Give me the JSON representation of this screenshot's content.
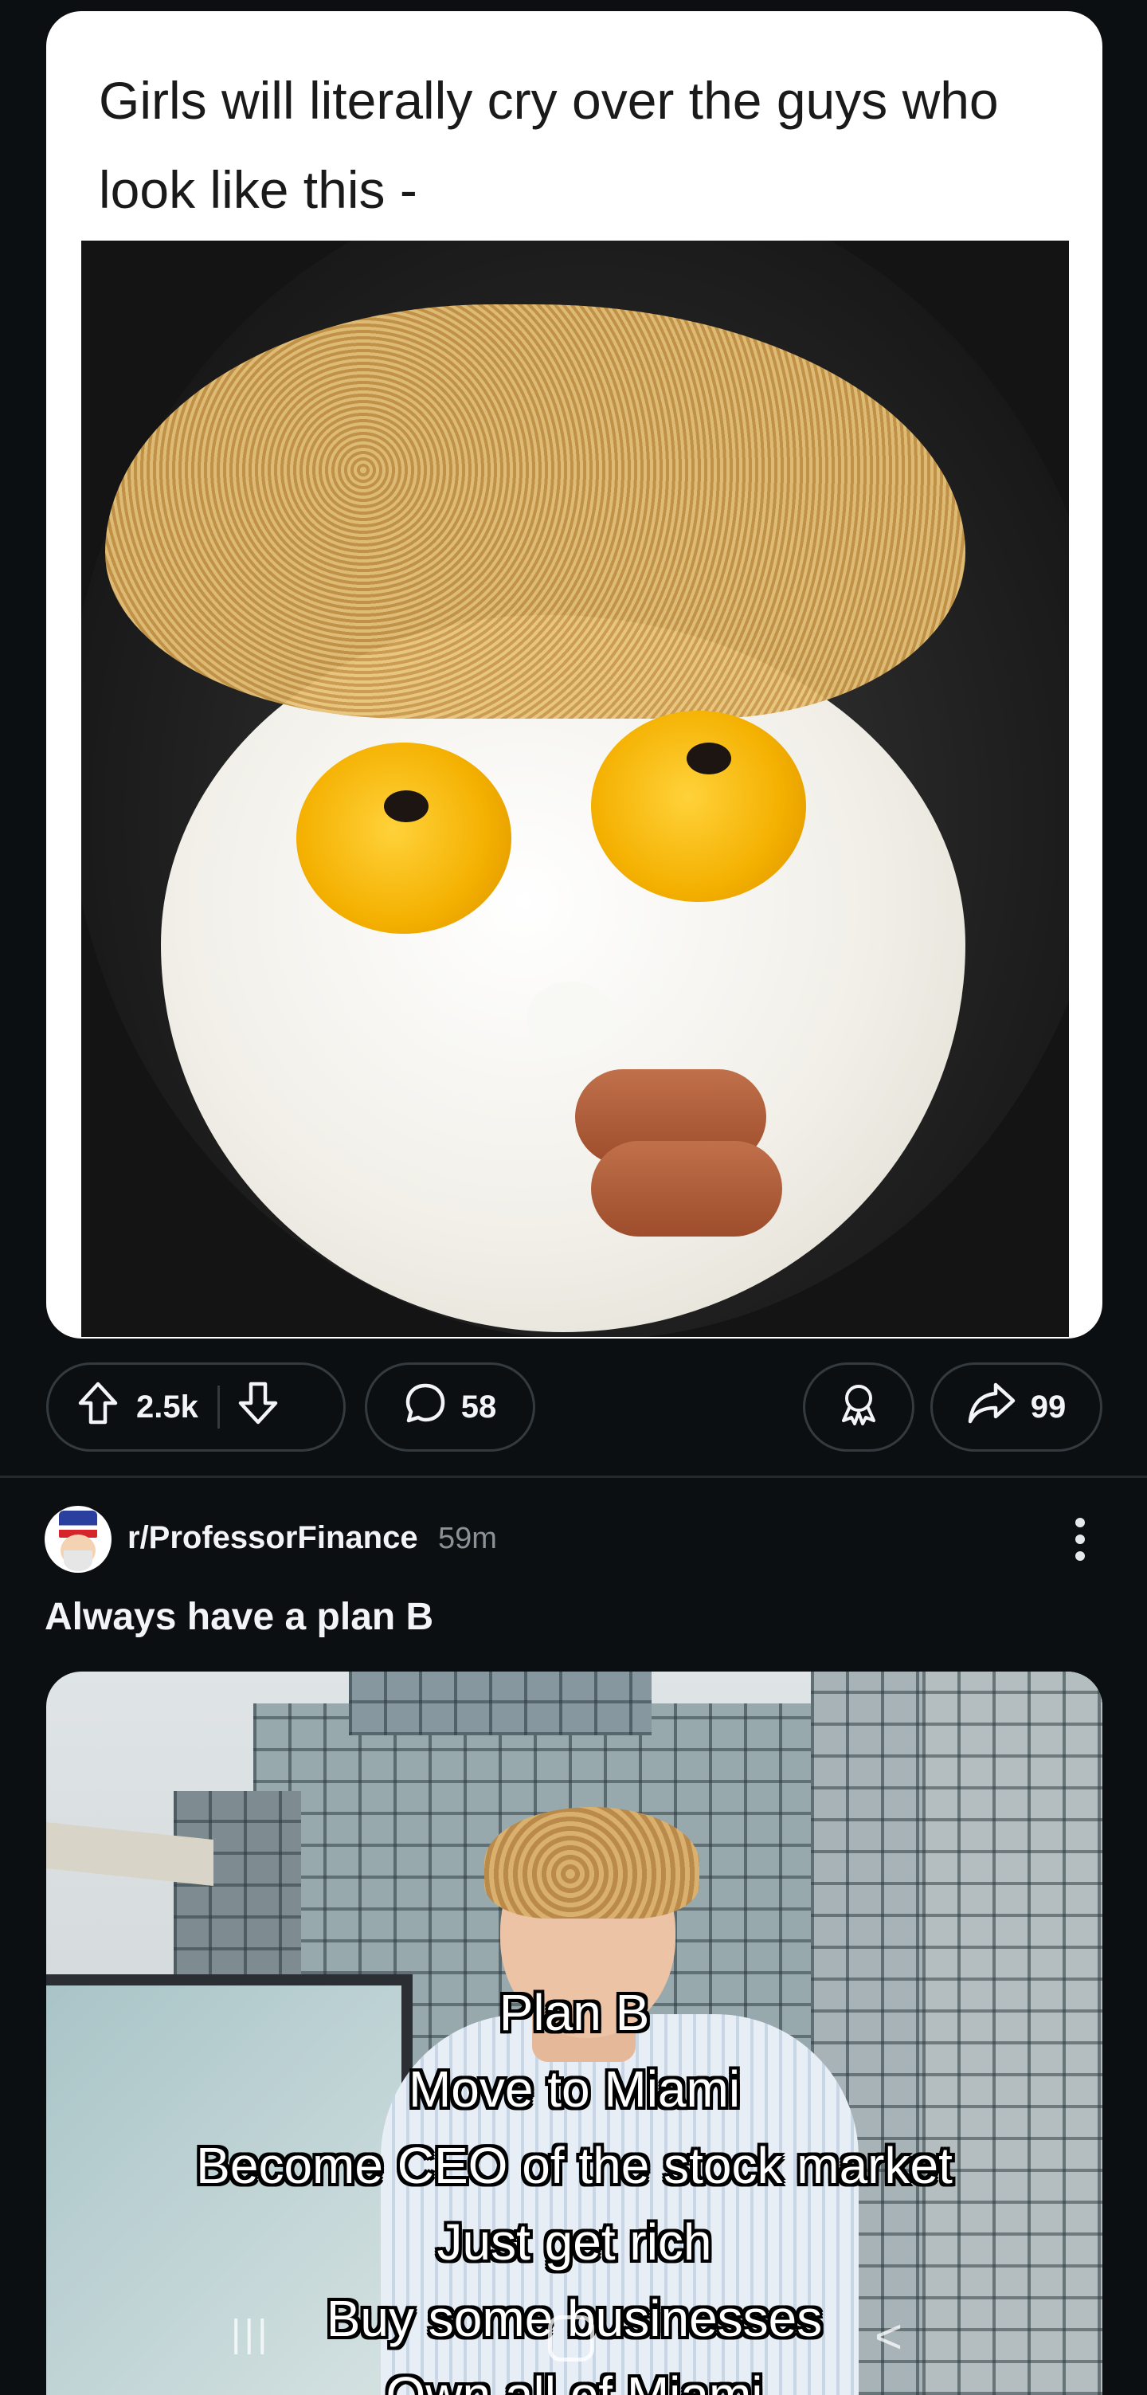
{
  "post1": {
    "caption": "Girls will literally cry over the guys who look like this -",
    "upvotes": "2.5k",
    "comments": "58",
    "shares": "99"
  },
  "post2": {
    "subreddit": "r/ProfessorFinance",
    "time": "59m",
    "title": "Always have a plan B",
    "overlay_lines": [
      "Plan B",
      "Move to Miami",
      "Become CEO of the stock market",
      "Just get rich",
      "Buy some businesses",
      "Own all of Miami"
    ]
  },
  "icons": {
    "upvote": "arrow-up-icon",
    "downvote": "arrow-down-icon",
    "comment": "speech-bubble-icon",
    "award": "award-icon",
    "share": "share-arrow-icon",
    "more": "more-vertical-icon"
  },
  "colors": {
    "background": "#0b0f12",
    "pill_border": "#343b40",
    "muted_text": "#8a9298"
  }
}
